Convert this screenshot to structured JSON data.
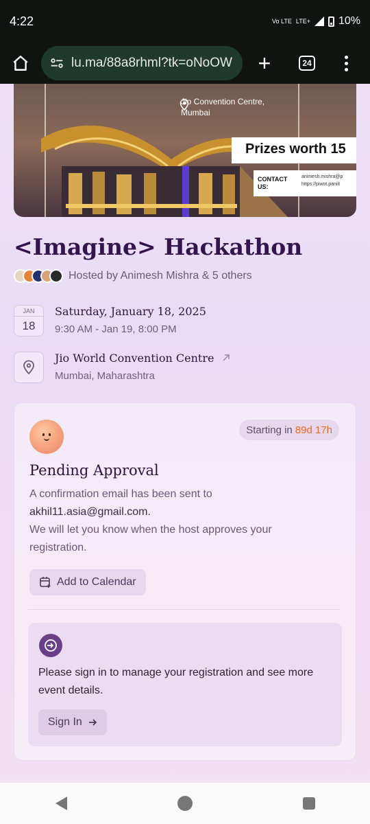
{
  "status_bar": {
    "time": "4:22",
    "network_top": "Vo LTE",
    "network_type": "LTE+",
    "battery": "10%"
  },
  "browser": {
    "url": "lu.ma/88a8rhml?tk=oNoOW",
    "tab_count": "24"
  },
  "banner": {
    "location_line1": "Jio Convention Centre,",
    "location_line2": "Mumbai",
    "prizes": "Prizes worth 15",
    "contact_label": "CONTACT US:",
    "contact_email": "animesh.mishra@p",
    "contact_url": "https://piwot.paniit"
  },
  "event": {
    "title": "<Imagine> Hackathon",
    "host": "Hosted by Animesh Mishra & 5 others",
    "date_month": "JAN",
    "date_day": "18",
    "date_main": "Saturday, January 18, 2025",
    "date_sub": "9:30 AM - Jan 19, 8:00 PM",
    "venue_main": "Jio World Convention Centre",
    "venue_sub": "Mumbai, Maharashtra"
  },
  "registration": {
    "starting_label": "Starting in",
    "starting_value": "89d 17h",
    "status_title": "Pending Approval",
    "text_line1": "A confirmation email has been sent to",
    "email": "akhil11.asia@gmail.com.",
    "text_line2": "We will let you know when the host approves your registration.",
    "calendar_button": "Add to Calendar",
    "signin_text": "Please sign in to manage your registration and see more event details.",
    "signin_button": "Sign In"
  },
  "colors": {
    "accent_orange": "#e56a2b",
    "title_purple": "#33144d",
    "signin_icon_bg": "#6a3f8a"
  }
}
